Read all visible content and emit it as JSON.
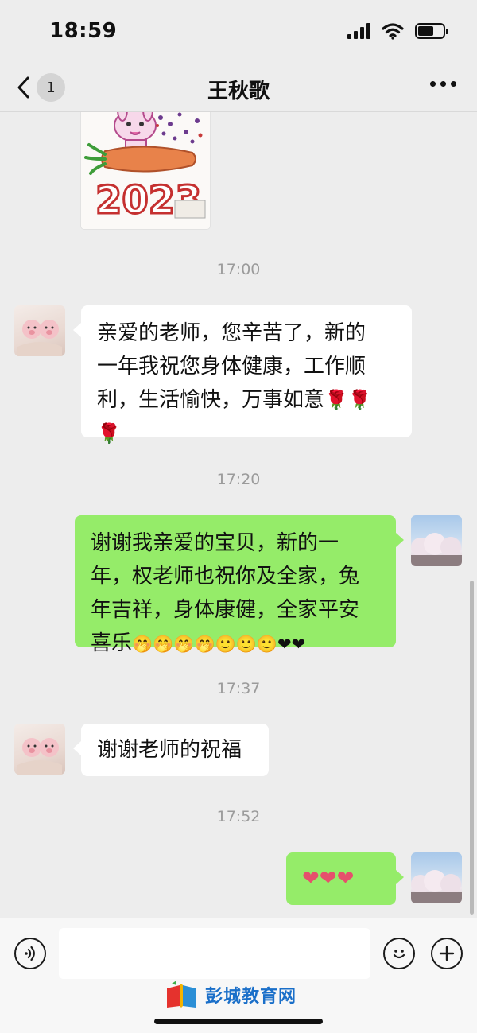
{
  "status_bar": {
    "time": "18:59",
    "battery_level": 0.62
  },
  "nav": {
    "back_badge": "1",
    "title": "王秋歌"
  },
  "image_message": {
    "year_text": "2023"
  },
  "messages": [
    {
      "timestamp": "17:00",
      "side": "left",
      "line1": "亲爱的老师，您辛苦了，新的",
      "line2": "一年我祝您身体健康，工作顺",
      "line3": "利，生活愉快，万事如意",
      "line3_emoji": "🌹🌹",
      "line4_emoji": "🌹"
    },
    {
      "timestamp": "17:20",
      "side": "right",
      "line1": "谢谢我亲爱的宝贝，新的一",
      "line2": "年，权老师也祝你及全家，兔",
      "line3": "年吉祥，身体康健，全家平安",
      "line4": "喜乐",
      "line4_emoji": "🤭🤭🤭🤭🙂🙂🙂❤❤"
    },
    {
      "timestamp": "17:37",
      "side": "left",
      "text": "谢谢老师的祝福"
    },
    {
      "timestamp": "17:52",
      "side": "right",
      "emoji": "❤❤❤"
    }
  ],
  "input_bar": {
    "placeholder": ""
  },
  "watermark": {
    "text": "彭城教育网"
  },
  "colors": {
    "bubble_green": "#95ec69",
    "background": "#ededed"
  },
  "icons": [
    "back-chevron-icon",
    "more-icon",
    "voice-icon",
    "emoji-icon",
    "add-icon",
    "book-logo-icon"
  ]
}
